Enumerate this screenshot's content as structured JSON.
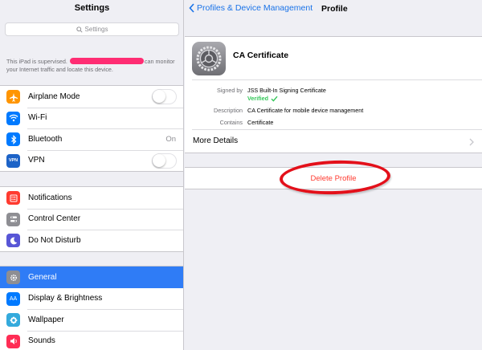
{
  "sidebar": {
    "title": "Settings",
    "search_placeholder": "Settings",
    "supervised_text_pre": "This iPad is supervised.",
    "supervised_text_post": "can monitor your Internet traffic and locate this device.",
    "group1": [
      {
        "label": "Airplane Mode",
        "icon": "airplane-icon",
        "color": "#ff9500",
        "control": "toggle",
        "on": false
      },
      {
        "label": "Wi-Fi",
        "icon": "wifi-icon",
        "color": "#007aff",
        "control": "none"
      },
      {
        "label": "Bluetooth",
        "icon": "bluetooth-icon",
        "color": "#007aff",
        "control": "value",
        "value": "On"
      },
      {
        "label": "VPN",
        "icon": "vpn-icon",
        "color": "#1d63c7",
        "icon_text": "VPN",
        "control": "toggle",
        "on": false
      }
    ],
    "group2": [
      {
        "label": "Notifications",
        "icon": "notifications-icon",
        "color": "#ff3b30"
      },
      {
        "label": "Control Center",
        "icon": "control-center-icon",
        "color": "#8e8e93"
      },
      {
        "label": "Do Not Disturb",
        "icon": "moon-icon",
        "color": "#5856d6"
      }
    ],
    "group3": [
      {
        "label": "General",
        "icon": "gear-icon",
        "color": "#8e8e93",
        "selected": true
      },
      {
        "label": "Display & Brightness",
        "icon": "display-icon",
        "color": "#007aff",
        "icon_text": "AA"
      },
      {
        "label": "Wallpaper",
        "icon": "wallpaper-icon",
        "color": "#34aadc"
      },
      {
        "label": "Sounds",
        "icon": "speaker-icon",
        "color": "#ff2d55"
      }
    ]
  },
  "detail": {
    "back_label": "Profiles & Device Management",
    "title": "Profile",
    "cert_name": "CA Certificate",
    "signed_by_label": "Signed by",
    "signed_by_value": "JSS Built-In Signing Certificate",
    "verified_label": "Verified",
    "description_label": "Description",
    "description_value": "CA Certificate for mobile device management",
    "contains_label": "Contains",
    "contains_value": "Certificate",
    "more_details_label": "More Details",
    "delete_label": "Delete Profile"
  },
  "colors": {
    "accent": "#1a73e8",
    "selected_row": "#2f7cf6",
    "destructive": "#ff3b30",
    "verified": "#34c759",
    "annotation": "#e3101a",
    "redaction": "#ff2d73"
  }
}
